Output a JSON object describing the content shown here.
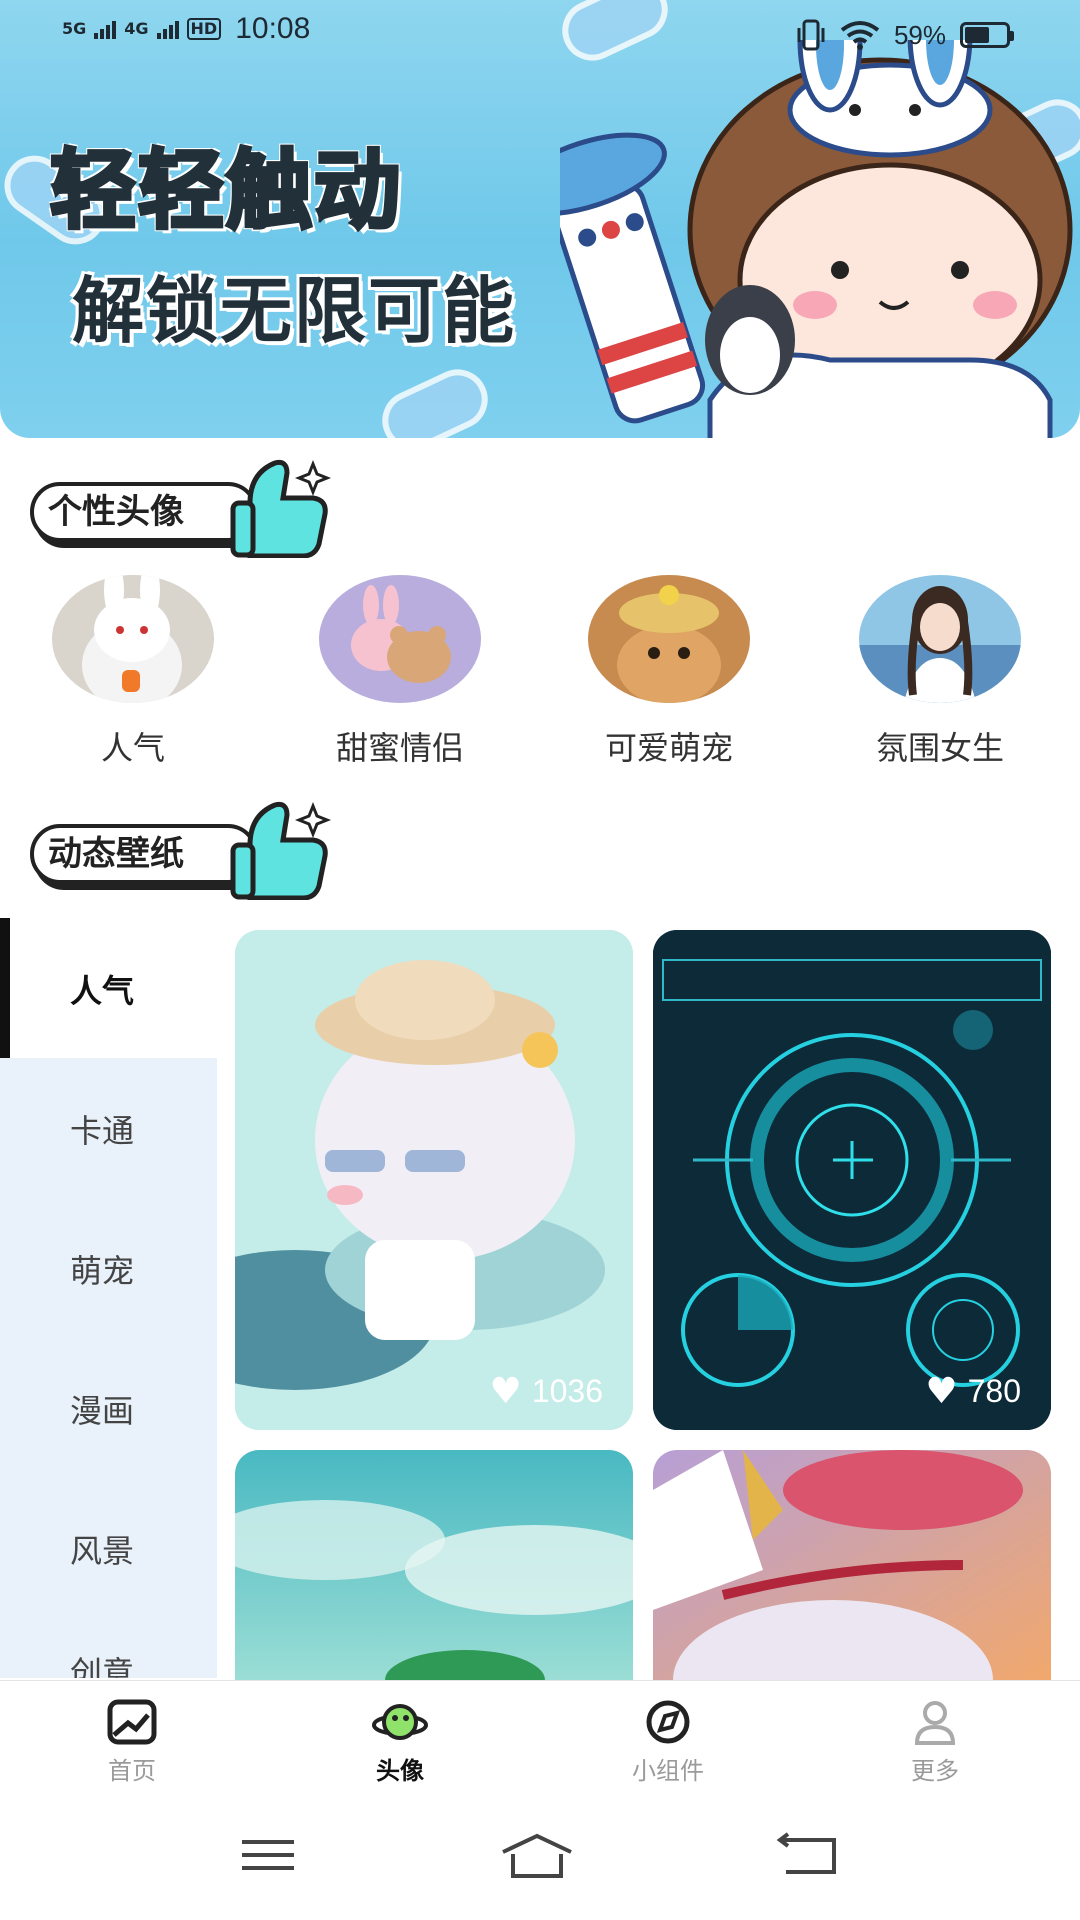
{
  "status_bar": {
    "network1": "5G",
    "network2": "4G",
    "hd": "HD",
    "time": "10:08",
    "battery_pct": "59%"
  },
  "banner": {
    "line1": "轻轻触动",
    "line2": "解锁无限可能",
    "background_color": "#7fd0ee"
  },
  "sections": {
    "avatars_title": "个性头像",
    "wallpapers_title": "动态壁纸"
  },
  "avatars": [
    {
      "label": "人气",
      "icon": "white-rabbit-avatar"
    },
    {
      "label": "甜蜜情侣",
      "icon": "bunny-bear-avatar"
    },
    {
      "label": "可爱萌宠",
      "icon": "cat-in-hat-avatar"
    },
    {
      "label": "氛围女生",
      "icon": "girl-portrait-avatar"
    }
  ],
  "categories": [
    {
      "label": "人气",
      "active": true
    },
    {
      "label": "卡通",
      "active": false
    },
    {
      "label": "萌宠",
      "active": false
    },
    {
      "label": "漫画",
      "active": false
    },
    {
      "label": "风景",
      "active": false
    },
    {
      "label": "创意",
      "active": false
    }
  ],
  "wallpapers": [
    {
      "likes": "1036",
      "theme": "anime-girl-hat"
    },
    {
      "likes": "780",
      "theme": "sci-fi-hud"
    },
    {
      "likes": "",
      "theme": "sky-clouds"
    },
    {
      "likes": "",
      "theme": "fox-mask-girl"
    }
  ],
  "bottom_nav": [
    {
      "label": "首页",
      "icon": "photo-icon",
      "active": false
    },
    {
      "label": "头像",
      "icon": "planet-icon",
      "active": true
    },
    {
      "label": "小组件",
      "icon": "compass-icon",
      "active": false
    },
    {
      "label": "更多",
      "icon": "user-icon",
      "active": false
    }
  ],
  "accent_color": "#5fe3e0"
}
